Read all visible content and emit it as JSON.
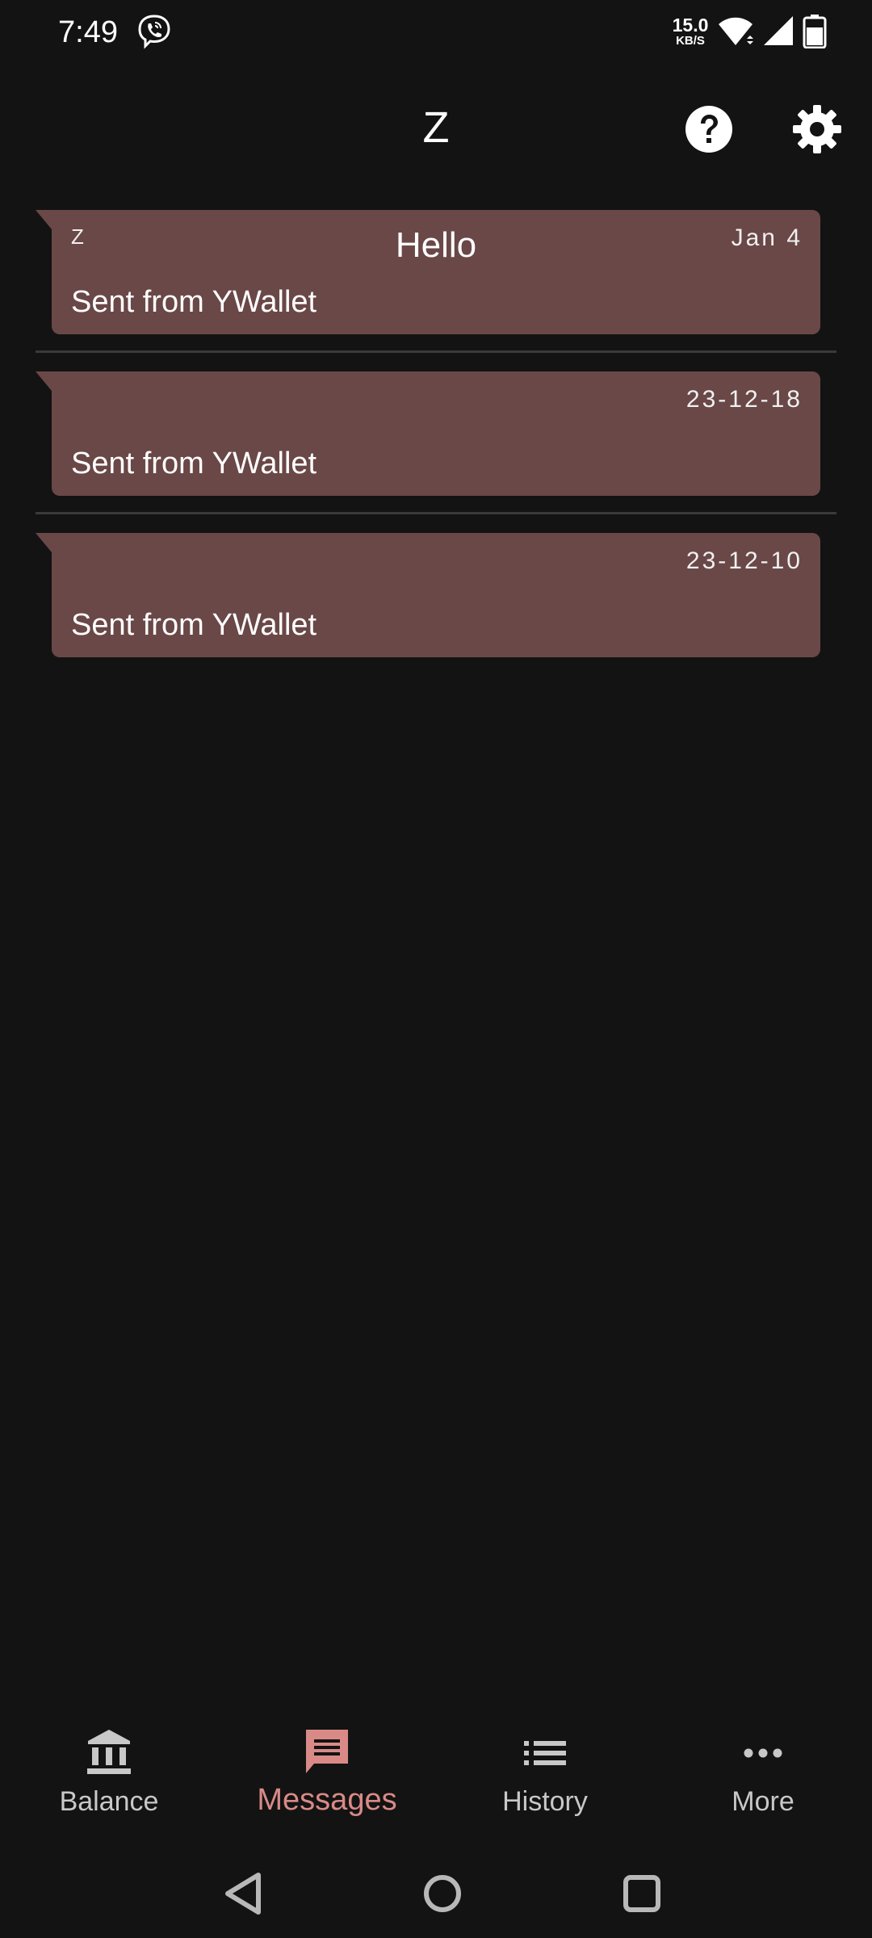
{
  "status_bar": {
    "time": "7:49",
    "net_speed_value": "15.0",
    "net_speed_unit": "KB/S",
    "icons": [
      "viber-icon",
      "wifi-icon",
      "signal-icon",
      "battery-icon"
    ]
  },
  "app_bar": {
    "title": "Z",
    "help_icon": "help-circle-icon",
    "settings_icon": "gear-icon"
  },
  "messages": [
    {
      "sender": "Z",
      "subject": "Hello",
      "date": "Jan 4",
      "body": "Sent from YWallet"
    },
    {
      "sender": "",
      "subject": "",
      "date": "23-12-18",
      "body": "Sent from YWallet"
    },
    {
      "sender": "",
      "subject": "",
      "date": "23-12-10",
      "body": "Sent from YWallet"
    }
  ],
  "bottom_nav": {
    "items": [
      {
        "label": "Balance",
        "icon": "bank-icon",
        "active": false
      },
      {
        "label": "Messages",
        "icon": "message-icon",
        "active": true
      },
      {
        "label": "History",
        "icon": "list-icon",
        "active": false
      },
      {
        "label": "More",
        "icon": "more-horizontal-icon",
        "active": false
      }
    ]
  },
  "colors": {
    "background": "#131313",
    "bubble": "#6a4847",
    "accent": "#d98a87",
    "nav_inactive": "#c8c8c8"
  },
  "system_nav": [
    "back-icon",
    "home-icon",
    "recents-icon"
  ]
}
